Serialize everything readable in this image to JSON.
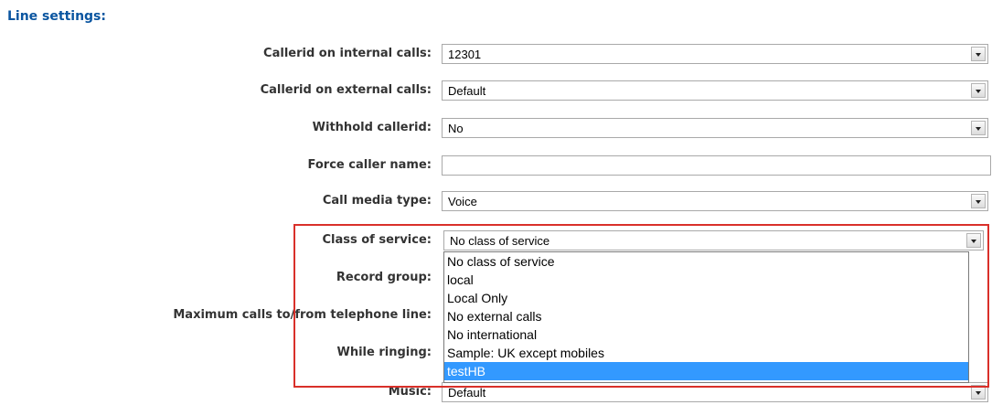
{
  "section": {
    "title": "Line settings:"
  },
  "fields": {
    "callerid_internal": {
      "label": "Callerid on internal calls:",
      "value": "12301"
    },
    "callerid_external": {
      "label": "Callerid on external calls:",
      "value": "Default"
    },
    "withhold_callerid": {
      "label": "Withhold callerid:",
      "value": "No"
    },
    "force_caller_name": {
      "label": "Force caller name:",
      "value": ""
    },
    "call_media_type": {
      "label": "Call media type:",
      "value": "Voice"
    },
    "class_of_service": {
      "label": "Class of service:",
      "value": "No class of service"
    },
    "record_group": {
      "label": "Record group:"
    },
    "max_calls": {
      "label": "Maximum calls to/from telephone line:"
    },
    "while_ringing": {
      "label": "While ringing:"
    },
    "music": {
      "label": "Music:",
      "value": "Default"
    }
  },
  "class_of_service_options": [
    {
      "label": "No class of service"
    },
    {
      "label": "local"
    },
    {
      "label": "Local Only"
    },
    {
      "label": "No external calls"
    },
    {
      "label": "No international"
    },
    {
      "label": "Sample: UK except mobiles"
    },
    {
      "label": "testHB",
      "highlighted": true
    }
  ],
  "colors": {
    "section_title": "#0a55a0",
    "highlight_border": "#d9302a",
    "selected_option_bg": "#3399ff"
  }
}
